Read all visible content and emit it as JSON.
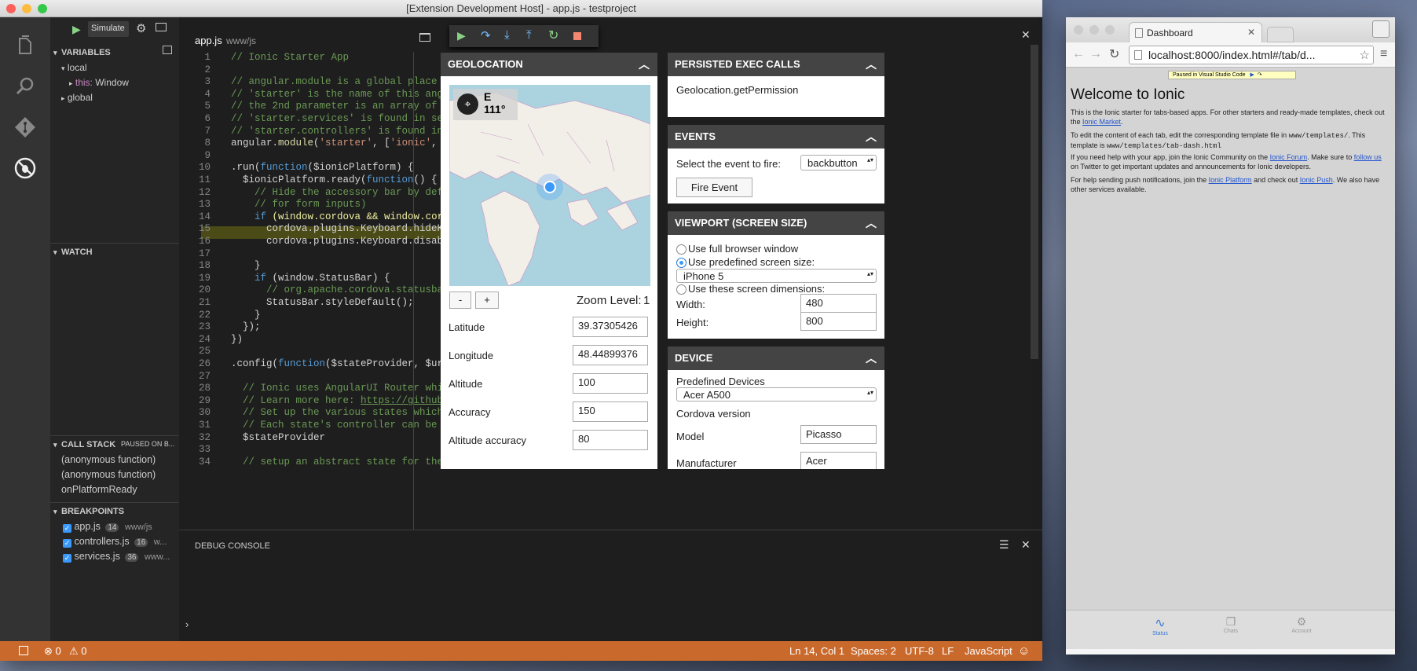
{
  "window": {
    "title": "[Extension Development Host] - app.js - testproject"
  },
  "debug_toolbar": {
    "config": "Simulate",
    "actions": [
      "continue",
      "step-over",
      "step-into",
      "step-out",
      "restart",
      "stop"
    ]
  },
  "sidebar": {
    "variables_label": "VARIABLES",
    "local_label": "local",
    "this_key": "this:",
    "this_value": "Window",
    "global_label": "global",
    "watch_label": "WATCH",
    "callstack_label": "CALL STACK",
    "callstack_status": "PAUSED ON B...",
    "callstack": [
      "(anonymous function)",
      "(anonymous function)",
      "onPlatformReady"
    ],
    "breakpoints_label": "BREAKPOINTS",
    "breakpoints": [
      {
        "file": "app.js",
        "line": "14",
        "path": "www/js"
      },
      {
        "file": "controllers.js",
        "line": "16",
        "path": "w..."
      },
      {
        "file": "services.js",
        "line": "36",
        "path": "www..."
      }
    ]
  },
  "editor": {
    "tab": "app.js",
    "tab_path": "www/js",
    "line_numbers": [
      "1",
      "2",
      "3",
      "4",
      "5",
      "6",
      "7",
      "8",
      "9",
      "10",
      "11",
      "12",
      "13",
      "14",
      "15",
      "16",
      "17",
      "18",
      "19",
      "20",
      "21",
      "22",
      "23",
      "24",
      "25",
      "26",
      "27",
      "28",
      "29",
      "30",
      "31",
      "32",
      "33",
      "34"
    ],
    "current_line": "14"
  },
  "debug_console": {
    "label": "DEBUG CONSOLE"
  },
  "statusbar": {
    "errors": "0",
    "warnings": "0",
    "position": "Ln 14, Col 1",
    "spaces": "Spaces: 2",
    "encoding": "UTF-8",
    "eol": "LF",
    "language": "JavaScript"
  },
  "geolocation": {
    "title": "GEOLOCATION",
    "compass_dir": "E",
    "compass_deg": "111°",
    "zoom_minus": "-",
    "zoom_plus": "+",
    "zoom_label": "Zoom Level:",
    "zoom_value": "1",
    "latitude_label": "Latitude",
    "latitude": "39.37305426",
    "longitude_label": "Longitude",
    "longitude": "48.44899376",
    "altitude_label": "Altitude",
    "altitude": "100",
    "accuracy_label": "Accuracy",
    "accuracy": "150",
    "alt_accuracy_label": "Altitude accuracy",
    "alt_accuracy": "80"
  },
  "persisted": {
    "title": "PERSISTED EXEC CALLS",
    "call": "Geolocation.getPermission"
  },
  "events": {
    "title": "EVENTS",
    "select_label": "Select the event to fire:",
    "selected": "backbutton",
    "fire_button": "Fire Event"
  },
  "viewport": {
    "title": "VIEWPORT (SCREEN SIZE)",
    "opt_full": "Use full browser window",
    "opt_predef": "Use predefined screen size:",
    "predef_value": "iPhone 5",
    "opt_custom": "Use these screen dimensions:",
    "width_label": "Width:",
    "width": "480",
    "height_label": "Height:",
    "height": "800"
  },
  "device": {
    "title": "DEVICE",
    "predef_label": "Predefined Devices",
    "predef_value": "Acer A500",
    "cordova_label": "Cordova version",
    "model_label": "Model",
    "model": "Picasso",
    "manufacturer_label": "Manufacturer",
    "manufacturer": "Acer"
  },
  "browser": {
    "tab_title": "Dashboard",
    "url": "localhost:8000/index.html#/tab/d...",
    "paused_banner": "Paused in Visual Studio Code",
    "heading": "Welcome to Ionic",
    "p1a": "This is the Ionic starter for tabs-based apps. For other starters and ready-made templates, check out the ",
    "p1link": "Ionic Market",
    "p2a": "To edit the content of each tab, edit the corresponding template file in ",
    "p2code": "www/templates/",
    "p2b": ". This template is ",
    "p2code2": "www/templates/tab-dash.html",
    "p3a": "If you need help with your app, join the Ionic Community on the ",
    "p3link": "Ionic Forum",
    "p3b": ". Make sure to ",
    "p3link2": "follow us",
    "p3c": " on Twitter to get important updates and announcements for Ionic developers.",
    "p4a": "For help sending push notifications, join the ",
    "p4link": "Ionic Platform",
    "p4b": " and check out ",
    "p4link2": "Ionic Push",
    "p4c": ". We also have other services available.",
    "tabs": [
      "Status",
      "Chats",
      "Account"
    ]
  },
  "colors": {
    "status_bar": "#c96a2c",
    "accent": "#3b99fc",
    "panel_header": "#444444"
  }
}
